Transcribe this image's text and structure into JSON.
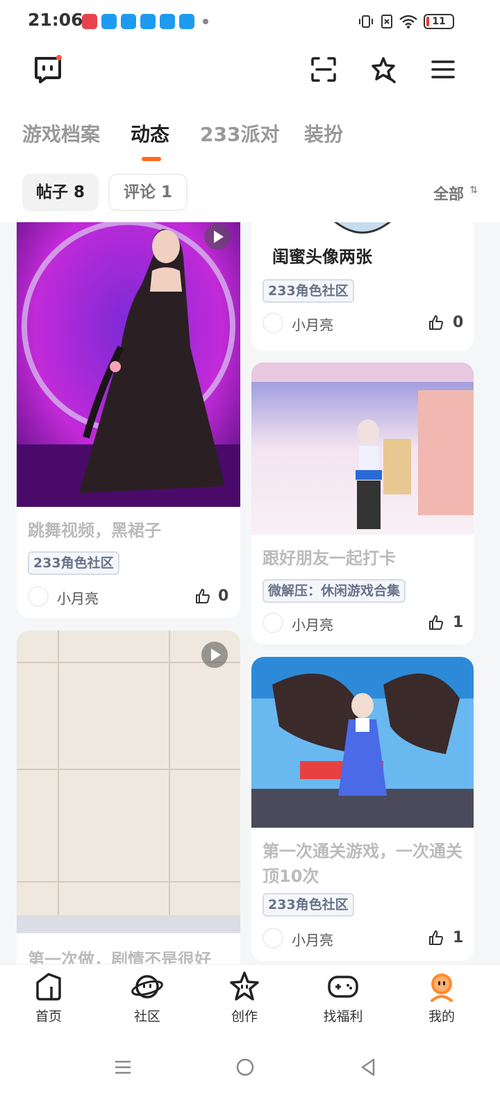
{
  "status_bar": {
    "time": "21:06",
    "battery": "11"
  },
  "tabs": [
    {
      "label": "游戏档案"
    },
    {
      "label": "动态"
    },
    {
      "label": "233派对"
    },
    {
      "label": "装扮"
    }
  ],
  "filters": {
    "posts": "帖子 8",
    "comments": "评论 1",
    "sort": "全部"
  },
  "cards": [
    {
      "title": "跳舞视频，黑裙子",
      "tag": "233角色社区",
      "author": "小月亮",
      "likes": "0"
    },
    {
      "title": "闺蜜头像两张",
      "tag": "233角色社区",
      "author": "小月亮",
      "likes": "0"
    },
    {
      "title": "跟好朋友一起打卡",
      "tag": "微解压：休闲游戏合集",
      "author": "小月亮",
      "likes": "1"
    },
    {
      "title": "第一次做，剧情不是很好"
    },
    {
      "title": "第一次通关游戏，一次通关顶10次",
      "tag": "233角色社区",
      "author": "小月亮",
      "likes": "1"
    }
  ],
  "bottom_nav": [
    {
      "label": "首页"
    },
    {
      "label": "社区"
    },
    {
      "label": "创作"
    },
    {
      "label": "找福利"
    },
    {
      "label": "我的"
    }
  ],
  "colors": {
    "accent": "#ff6a1a",
    "tag_border": "#d6dbe4"
  }
}
